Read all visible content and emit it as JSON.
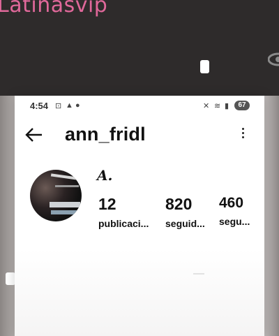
{
  "banner": {
    "brand_text": "Latinasvip"
  },
  "status_bar": {
    "time": "4:54",
    "battery": "67"
  },
  "profile": {
    "username": "ann_fridl",
    "display_name": "A.",
    "stats": [
      {
        "value": "12",
        "label": "publicaci..."
      },
      {
        "value": "820",
        "label": "seguid..."
      },
      {
        "value": "460",
        "label": "segu..."
      }
    ]
  },
  "colors": {
    "brand": "#e0689a",
    "banner_bg": "#2e2b2b"
  },
  "icons": [
    "eye-icon",
    "back-arrow-icon",
    "more-options-icon"
  ]
}
